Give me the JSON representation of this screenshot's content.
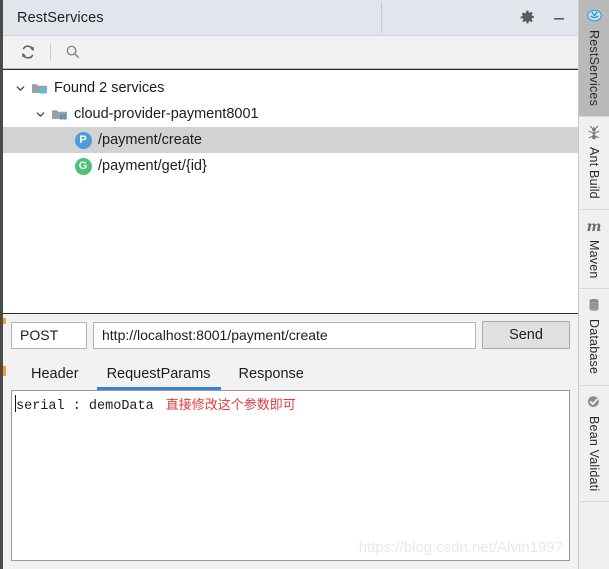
{
  "window": {
    "title": "RestServices",
    "settings_icon": "gear-icon",
    "minimize_icon": "minimize-icon"
  },
  "toolbar": {
    "refresh_icon": "refresh-icon",
    "search_icon": "search-icon"
  },
  "tree": {
    "nodes": [
      {
        "label": "Found 2 services",
        "icon": "folder-services-icon",
        "expanded": true,
        "indent": 0,
        "selected": false
      },
      {
        "label": "cloud-provider-payment8001",
        "icon": "module-icon",
        "expanded": true,
        "indent": 1,
        "selected": false
      },
      {
        "label": "/payment/create",
        "icon": "post-badge",
        "badge": "P",
        "indent": 2,
        "selected": true
      },
      {
        "label": "/payment/get/{id}",
        "icon": "get-badge",
        "badge": "G",
        "indent": 2,
        "selected": false
      }
    ]
  },
  "request": {
    "method": "POST",
    "url": "http://localhost:8001/payment/create",
    "send_label": "Send"
  },
  "tabs": [
    {
      "label": "Header",
      "active": false
    },
    {
      "label": "RequestParams",
      "active": true
    },
    {
      "label": "Response",
      "active": false
    }
  ],
  "editor": {
    "params_text": "serial : demoData",
    "annotation": "直接修改这个参数即可",
    "watermark": "https://blog.csdn.net/Alvin1997"
  },
  "rail": {
    "items": [
      {
        "label": "RestServices",
        "icon": "restservices-icon",
        "active": true
      },
      {
        "label": "Ant Build",
        "icon": "ant-icon",
        "active": false
      },
      {
        "label": "Maven",
        "icon": "maven-m-icon",
        "active": false
      },
      {
        "label": "Database",
        "icon": "database-icon",
        "active": false
      },
      {
        "label": "Bean Validati",
        "icon": "bean-validation-icon",
        "active": false
      }
    ]
  },
  "colors": {
    "accent": "#3f7fcc",
    "post_badge": "#4f9cdc",
    "get_badge": "#4fc177",
    "annotation": "#e13c3c",
    "header_bg": "#e1e5ec",
    "selection": "#d2d2d2"
  }
}
